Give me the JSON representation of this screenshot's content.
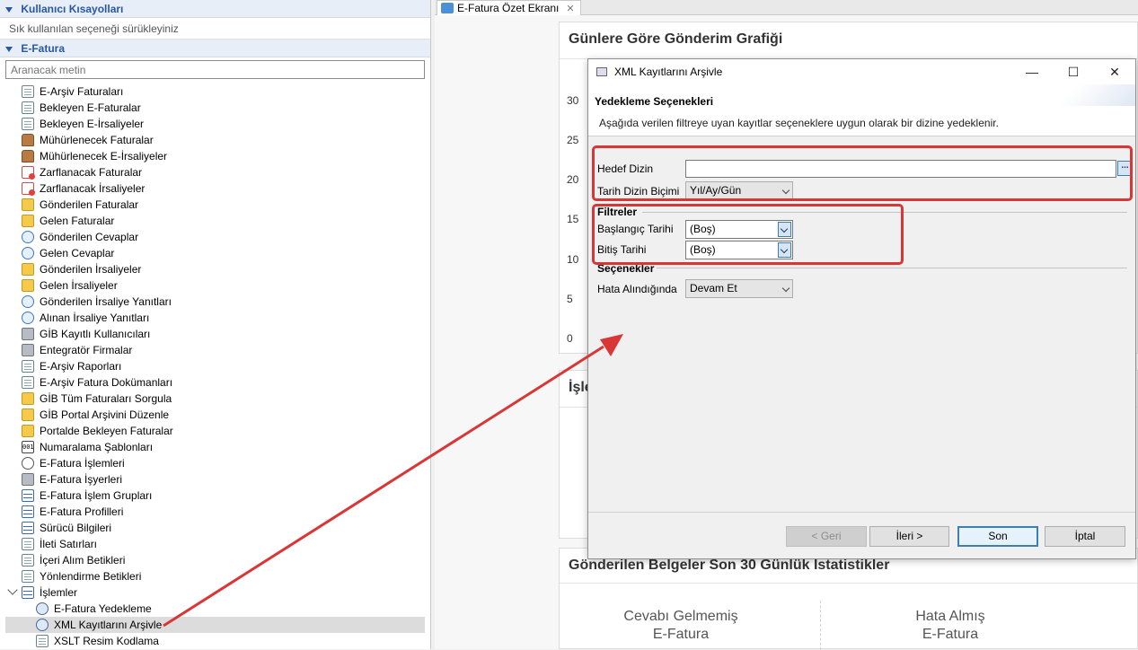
{
  "left_panel": {
    "shortcuts_header": "Kullanıcı Kısayolları",
    "shortcuts_hint": "Sık kullanılan seçeneği sürükleyiniz",
    "efatura_header": "E-Fatura",
    "search_placeholder": "Aranacak metin",
    "tree": [
      {
        "label": "E-Arşiv Faturaları",
        "icon": "document-icon"
      },
      {
        "label": "Bekleyen E-Faturalar",
        "icon": "document-icon"
      },
      {
        "label": "Bekleyen E-İrsaliyeler",
        "icon": "document-icon"
      },
      {
        "label": "Mühürlenecek Faturalar",
        "icon": "stamp-icon"
      },
      {
        "label": "Mühürlenecek E-İrsaliyeler",
        "icon": "stamp-icon"
      },
      {
        "label": "Zarflanacak Faturalar",
        "icon": "envelope-icon"
      },
      {
        "label": "Zarflanacak İrsaliyeler",
        "icon": "envelope-icon"
      },
      {
        "label": "Gönderilen Faturalar",
        "icon": "folder-icon"
      },
      {
        "label": "Gelen Faturalar",
        "icon": "folder-icon"
      },
      {
        "label": "Gönderilen Cevaplar",
        "icon": "reply-icon"
      },
      {
        "label": "Gelen Cevaplar",
        "icon": "reply-icon"
      },
      {
        "label": "Gönderilen İrsaliyeler",
        "icon": "folder-icon"
      },
      {
        "label": "Gelen İrsaliyeler",
        "icon": "folder-icon"
      },
      {
        "label": "Gönderilen İrsaliye Yanıtları",
        "icon": "reply-icon"
      },
      {
        "label": "Alınan İrsaliye Yanıtları",
        "icon": "reply-icon"
      },
      {
        "label": "GİB Kayıtlı Kullanıcıları",
        "icon": "building-icon"
      },
      {
        "label": "Entegratör Firmalar",
        "icon": "building-icon"
      },
      {
        "label": "E-Arşiv Raporları",
        "icon": "report-icon"
      },
      {
        "label": "E-Arşiv Fatura Dokümanları",
        "icon": "document-icon"
      },
      {
        "label": "GİB Tüm Faturaları Sorgula",
        "icon": "query-icon"
      },
      {
        "label": "GİB Portal Arşivini Düzenle",
        "icon": "archive-icon"
      },
      {
        "label": "Portalde Bekleyen Faturalar",
        "icon": "document-icon"
      },
      {
        "label": "Numaralama Şablonları",
        "icon": "numbering-icon"
      },
      {
        "label": "E-Fatura İşlemleri",
        "icon": "magnifier-icon"
      },
      {
        "label": "E-Fatura İşyerleri",
        "icon": "workplace-icon"
      },
      {
        "label": "E-Fatura İşlem Grupları",
        "icon": "grid-icon"
      },
      {
        "label": "E-Fatura Profilleri",
        "icon": "grid-icon"
      },
      {
        "label": "Sürücü Bilgileri",
        "icon": "grid-icon"
      },
      {
        "label": "İleti Satırları",
        "icon": "document-icon"
      },
      {
        "label": "İçeri Alım Betikleri",
        "icon": "document-icon"
      },
      {
        "label": "Yönlendirme Betikleri",
        "icon": "document-icon"
      }
    ],
    "processes_node": "İşlemler",
    "process_children": [
      {
        "label": "E-Fatura Yedekleme",
        "icon": "gear-icon"
      },
      {
        "label": "XML Kayıtlarını Arşivle",
        "icon": "gear-icon"
      },
      {
        "label": "XSLT Resim Kodlama",
        "icon": "image-icon"
      }
    ]
  },
  "editor": {
    "tab_label": "E-Fatura Özet Ekranı",
    "chart_title": "Günlere Göre Gönderim Grafiği",
    "ytick_labels": [
      "30",
      "25",
      "20",
      "15",
      "10",
      "5",
      "0"
    ],
    "islem_title_partial": "İşle",
    "stats_title": "Gönderilen Belgeler Son 30 Günlük İstatistikler",
    "stat_1_line1": "Cevabı Gelmemiş",
    "stat_1_line2": "E-Fatura",
    "stat_2_line1": "Hata Almış",
    "stat_2_line2": "E-Fatura"
  },
  "dialog": {
    "title": "XML Kayıtlarını Arşivle",
    "header_title": "Yedekleme Seçenekleri",
    "header_desc": "Aşağıda verilen filtreye uyan kayıtlar seçeneklere uygun olarak bir dizine yedeklenir.",
    "target_dir_label": "Hedef Dizin",
    "target_dir_value": "",
    "browse_label": "...",
    "date_format_label": "Tarih Dizin Biçimi",
    "date_format_value": "Yıl/Ay/Gün",
    "filters_group": "Filtreler",
    "start_date_label": "Başlangıç Tarihi",
    "start_date_value": "(Boş)",
    "end_date_label": "Bitiş Tarihi",
    "end_date_value": "(Boş)",
    "options_group": "Seçenekler",
    "on_error_label": "Hata Alındığında",
    "on_error_value": "Devam Et",
    "buttons": {
      "back": "< Geri",
      "next": "İleri >",
      "finish": "Son",
      "cancel": "İptal"
    },
    "window_controls": {
      "minimize": "—",
      "maximize": "☐",
      "close": "✕"
    }
  },
  "annotation_color": "#d93636"
}
